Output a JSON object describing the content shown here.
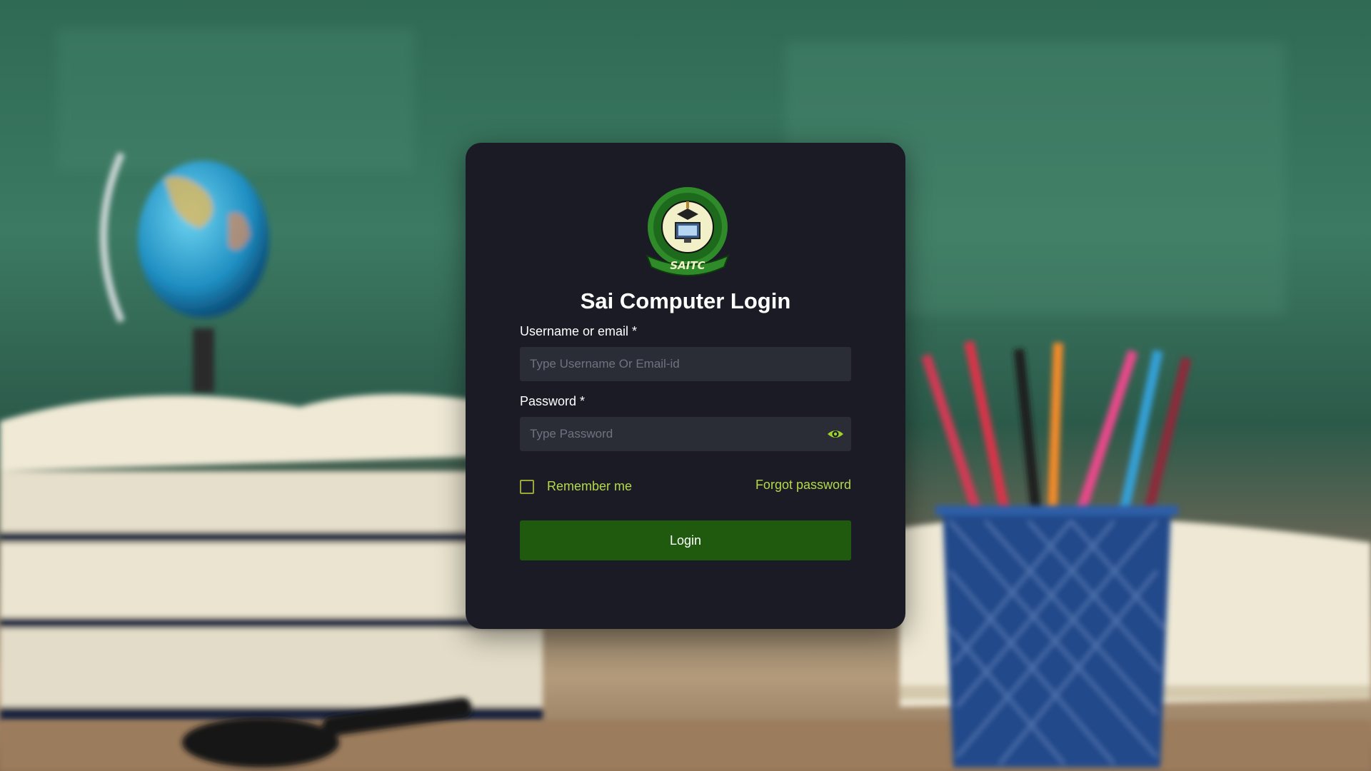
{
  "page": {
    "title": "Sai Computer Login"
  },
  "logo": {
    "text": "SAITC"
  },
  "form": {
    "username_label": "Username or email *",
    "username_placeholder": "Type Username Or Email-id",
    "password_label": "Password *",
    "password_placeholder": "Type Password",
    "remember_label": "Remember me",
    "forgot_label": "Forgot password",
    "login_label": "Login"
  },
  "icons": {
    "password_toggle": "eye-icon"
  },
  "colors": {
    "card_bg": "#1a1b24",
    "accent_green": "#b5d94a",
    "button_green": "#1f5a0f"
  }
}
